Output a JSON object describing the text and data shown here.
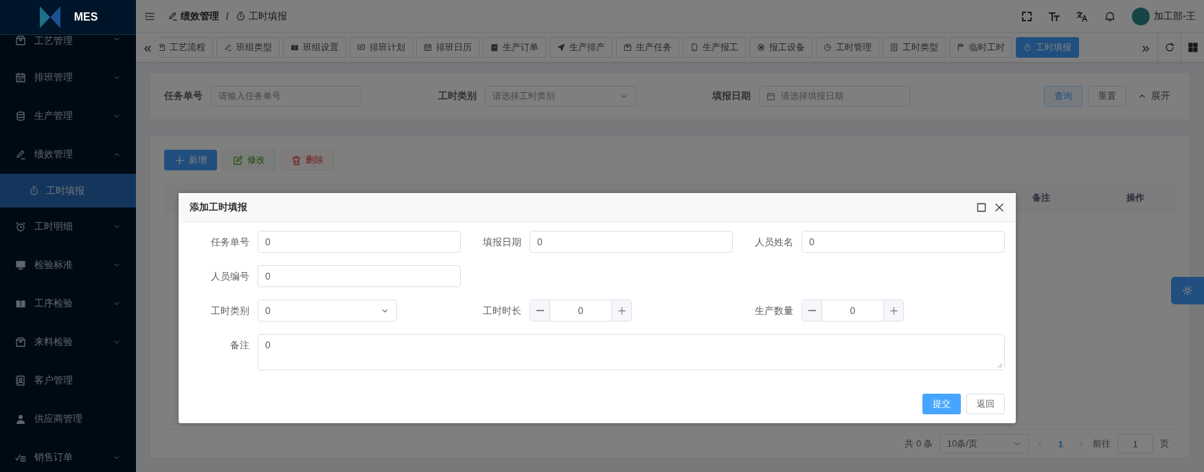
{
  "sidebar": {
    "logo": "MES",
    "items": [
      {
        "label": "工艺管理",
        "kind": "group",
        "expanded": false,
        "selected": false
      },
      {
        "label": "排班管理",
        "kind": "group",
        "expanded": false,
        "selected": false
      },
      {
        "label": "生产管理",
        "kind": "group",
        "expanded": false,
        "selected": false
      },
      {
        "label": "绩效管理",
        "kind": "group",
        "expanded": true,
        "selected": false,
        "children": [
          {
            "label": "工时填报",
            "selected": true
          }
        ]
      },
      {
        "label": "工时明细",
        "kind": "group",
        "expanded": false,
        "selected": false
      },
      {
        "label": "检验标准",
        "kind": "group",
        "expanded": false,
        "selected": false
      },
      {
        "label": "工序检验",
        "kind": "group",
        "expanded": false,
        "selected": false
      },
      {
        "label": "来料检验",
        "kind": "group",
        "expanded": false,
        "selected": false
      },
      {
        "label": "客户管理",
        "kind": "link",
        "selected": false
      },
      {
        "label": "供应商管理",
        "kind": "link",
        "selected": false
      },
      {
        "label": "销售订单",
        "kind": "group",
        "expanded": false,
        "selected": false
      }
    ]
  },
  "header": {
    "breadcrumb": [
      {
        "label": "绩效管理"
      },
      {
        "label": "工时填报"
      }
    ],
    "separator": "/",
    "user": "加工部-王"
  },
  "tags": {
    "scroll_left": "«",
    "scroll_right": "»",
    "items": [
      {
        "label": "工艺流程",
        "selected": false
      },
      {
        "label": "班组类型",
        "selected": false
      },
      {
        "label": "班组设置",
        "selected": false
      },
      {
        "label": "排班计划",
        "selected": false
      },
      {
        "label": "排班日历",
        "selected": false
      },
      {
        "label": "生产订单",
        "selected": false
      },
      {
        "label": "生产排产",
        "selected": false
      },
      {
        "label": "生产任务",
        "selected": false
      },
      {
        "label": "生产报工",
        "selected": false
      },
      {
        "label": "报工设备",
        "selected": false
      },
      {
        "label": "工时管理",
        "selected": false
      },
      {
        "label": "工时类型",
        "selected": false
      },
      {
        "label": "临时工时",
        "selected": false
      },
      {
        "label": "工时填报",
        "selected": true
      }
    ]
  },
  "query": {
    "fields": [
      {
        "label": "任务单号",
        "placeholder": "请输入任务单号",
        "kind": "text"
      },
      {
        "label": "工时类别",
        "placeholder": "请选择工时类别",
        "kind": "select"
      },
      {
        "label": "填报日期",
        "placeholder": "请选择填报日期",
        "kind": "date"
      }
    ],
    "buttons": [
      {
        "label": "查询",
        "kind": "primary"
      },
      {
        "label": "重置",
        "kind": "default"
      }
    ],
    "toggle": "展开"
  },
  "toolbar": {
    "buttons": [
      {
        "label": "新增",
        "kind": "primary",
        "disabled": false
      },
      {
        "label": "修改",
        "kind": "success",
        "disabled": true
      },
      {
        "label": "删除",
        "kind": "danger",
        "disabled": true
      }
    ]
  },
  "table": {
    "columns": [
      "备注",
      "操作"
    ]
  },
  "pagination": {
    "total": "共 0 条",
    "page_size": "10条/页",
    "current_page": "1",
    "goto_label": "前往",
    "goto_value": "1",
    "goto_suffix": "页"
  },
  "dialog": {
    "title": "添加工时填报",
    "rows": [
      [
        {
          "label": "任务单号",
          "value": "0",
          "kind": "text"
        },
        {
          "label": "填报日期",
          "value": "0",
          "kind": "text"
        },
        {
          "label": "人员姓名",
          "value": "0",
          "kind": "text"
        }
      ],
      [
        {
          "label": "人员编号",
          "value": "0",
          "kind": "text"
        }
      ],
      [
        {
          "label": "工时类别",
          "value": "0",
          "kind": "select"
        },
        {
          "label": "工时时长",
          "value": "0",
          "kind": "number"
        },
        {
          "label": "生产数量",
          "value": "0",
          "kind": "number"
        }
      ],
      [
        {
          "label": "备注",
          "value": "0",
          "kind": "textarea"
        }
      ]
    ],
    "buttons": [
      {
        "label": "提交",
        "kind": "primary"
      },
      {
        "label": "返回",
        "kind": "default"
      }
    ]
  }
}
